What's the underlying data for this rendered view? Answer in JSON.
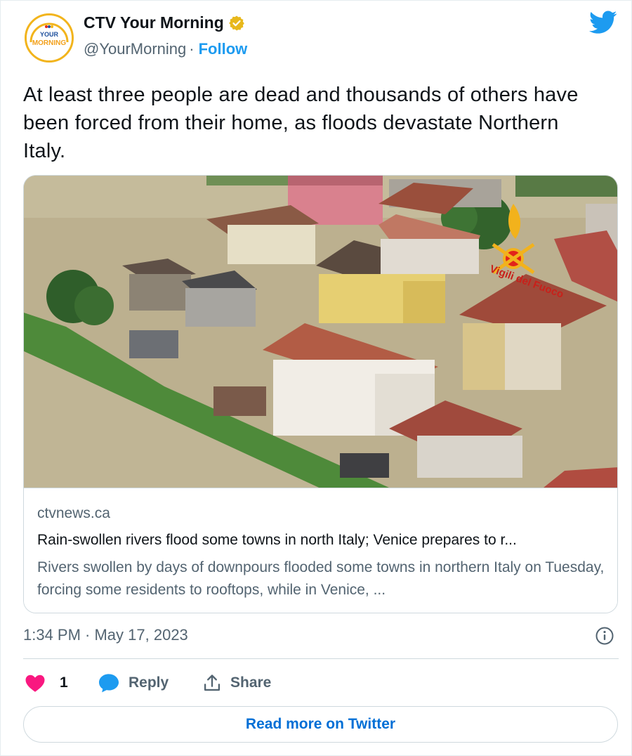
{
  "author": {
    "display_name": "CTV Your Morning",
    "handle": "@YourMorning",
    "separator": "·",
    "follow_label": "Follow",
    "avatar_text_top": "YOUR",
    "avatar_text_bottom": "MORNING",
    "verified_color": "#e8b81c"
  },
  "tweet": {
    "text": "At least three people are dead and thousands of others have been forced from their home, as floods devastate Northern Italy."
  },
  "card": {
    "domain": "ctvnews.ca",
    "title": "Rain-swollen rivers flood some towns in north Italy; Venice prepares to r...",
    "description": "Rivers swollen by days of downpours flooded some towns in northern Italy on Tuesday, forcing some residents to rooftops, while in Venice, ...",
    "image_watermark": "Vigili del Fuoco"
  },
  "meta": {
    "timestamp": "1:34 PM · May 17, 2023"
  },
  "actions": {
    "like_count": "1",
    "reply_label": "Reply",
    "share_label": "Share",
    "read_more_label": "Read more on Twitter"
  },
  "colors": {
    "twitter_blue": "#1d9bf0",
    "heart": "#f91880",
    "link": "#006fd6"
  }
}
